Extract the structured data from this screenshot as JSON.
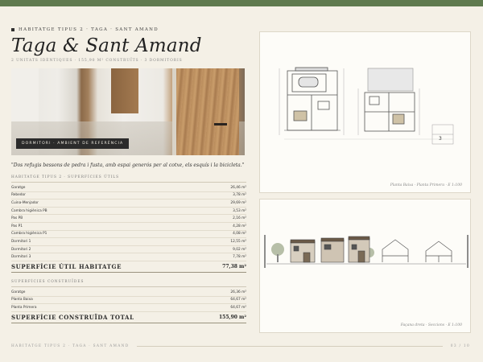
{
  "header": {
    "kicker": "HABITATGE TIPUS 2 · TAGA · SANT AMAND",
    "title": "Taga & Sant Amand",
    "subtitle": "2 UNITATS IDÈNTIQUES · 155,90 m² CONSTRUÏTS · 3 DORMITORIS"
  },
  "photo": {
    "caption": "DORMITORI · AMBIENT DE REFERÈNCIA"
  },
  "quote": "\"Dos refugis bessons de pedra i fusta, amb espai generós per al cotxe, els esquís i la bicicleta.\"",
  "useful_surfaces": {
    "heading": "HABITATGE TIPUS 2 · SUPERFÍCIES ÚTILS",
    "rows": [
      {
        "label": "Garatge",
        "value": "26,46 m²"
      },
      {
        "label": "Rebedor",
        "value": "3,78 m²"
      },
      {
        "label": "Cuina-Menjador",
        "value": "29,69 m²"
      },
      {
        "label": "Cambra higiènica PB",
        "value": "3,53 m²"
      },
      {
        "label": "Pas PB",
        "value": "2,16 m²"
      },
      {
        "label": "Pas P1",
        "value": "4,28 m²"
      },
      {
        "label": "Cambra higiènica P1",
        "value": "4,08 m²"
      },
      {
        "label": "Dormitori 1",
        "value": "12,55 m²"
      },
      {
        "label": "Dormitori 2",
        "value": "9,02 m²"
      },
      {
        "label": "Dormitori 3",
        "value": "7,78 m²"
      }
    ],
    "total_label": "SUPERFÍCIE ÚTIL HABITATGE",
    "total_value": "77,38 m²"
  },
  "built_surfaces": {
    "heading": "SUPERFÍCIES CONSTRUÏDES",
    "rows": [
      {
        "label": "Garatge",
        "value": "26,36 m²"
      },
      {
        "label": "Planta Baixa",
        "value": "64,67 m²"
      },
      {
        "label": "Planta Primera",
        "value": "64,67 m²"
      }
    ],
    "total_label": "SUPERFÍCIE CONSTRUÏDA TOTAL",
    "total_value": "155,90 m²"
  },
  "plans_card": {
    "caption": "Planta Baixa · Planta Primera · E 1:100"
  },
  "elevations_card": {
    "caption": "Façana dreta · Seccions · E 1:100"
  },
  "footer": {
    "left": "HABITATGE TIPUS 2 · TAGA · SANT AMAND",
    "right": "03 / 10"
  }
}
